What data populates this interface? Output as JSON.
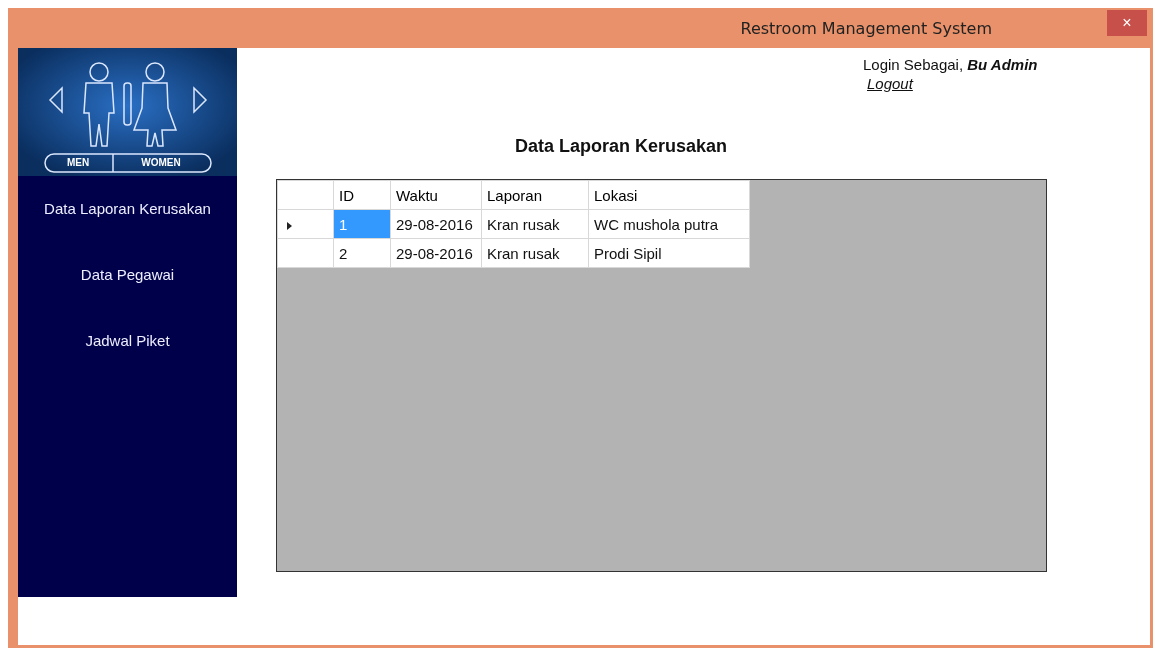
{
  "window": {
    "title": "Restroom Management System",
    "close": "×"
  },
  "logo": {
    "labels": [
      "MEN",
      "WOMEN"
    ]
  },
  "sidebar": {
    "items": [
      {
        "label": "Data Laporan Kerusakan"
      },
      {
        "label": "Data Pegawai"
      },
      {
        "label": "Jadwal Piket"
      }
    ]
  },
  "user": {
    "login_text": "Login Sebagai, **Bu Admin**",
    "logout": "Logout"
  },
  "page_title": "Data Laporan Kerusakan",
  "table": {
    "columns": [
      "ID",
      "Waktu",
      "Laporan",
      "Lokasi"
    ],
    "rows": [
      {
        "selected": true,
        "cells": [
          "1",
          "29-08-2016",
          "Kran rusak",
          "WC mushola putra"
        ]
      },
      {
        "selected": false,
        "cells": [
          "2",
          "29-08-2016",
          "Kran rusak",
          "Prodi Sipil"
        ]
      }
    ]
  }
}
